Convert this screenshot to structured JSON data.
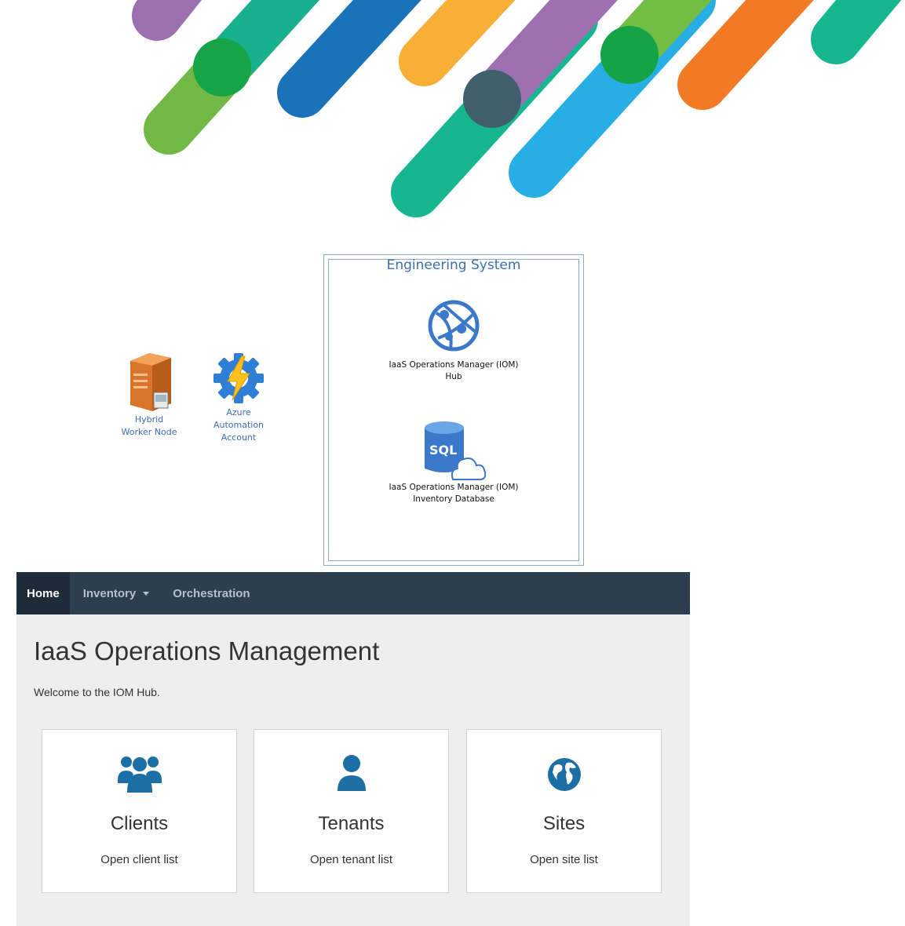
{
  "diagram": {
    "hybrid_worker": [
      "Hybrid",
      "Worker Node"
    ],
    "azure_automation": [
      "Azure",
      "Automation",
      "Account"
    ],
    "system_title": "Engineering System",
    "hub_caption": [
      "IaaS Operations Manager (IOM)",
      "Hub"
    ],
    "db_caption": [
      "IaaS Operations Manager (IOM)",
      "Inventory  Database"
    ],
    "sql_label": "SQL"
  },
  "nav": {
    "items": [
      {
        "label": "Home",
        "active": true
      },
      {
        "label": "Inventory",
        "dropdown": true
      },
      {
        "label": "Orchestration"
      }
    ]
  },
  "page": {
    "title": "IaaS Operations Management",
    "welcome": "Welcome to the IOM Hub."
  },
  "cards": [
    {
      "title": "Clients",
      "link": "Open client list",
      "icon": "users-icon"
    },
    {
      "title": "Tenants",
      "link": "Open tenant list",
      "icon": "user-icon"
    },
    {
      "title": "Sites",
      "link": "Open site list",
      "icon": "globe-icon"
    }
  ],
  "colors": {
    "nav_bg": "#2d3e50",
    "nav_active_bg": "#1e2b38",
    "icon_blue": "#1b6fa5",
    "diagram_blue": "#3d6fae"
  }
}
